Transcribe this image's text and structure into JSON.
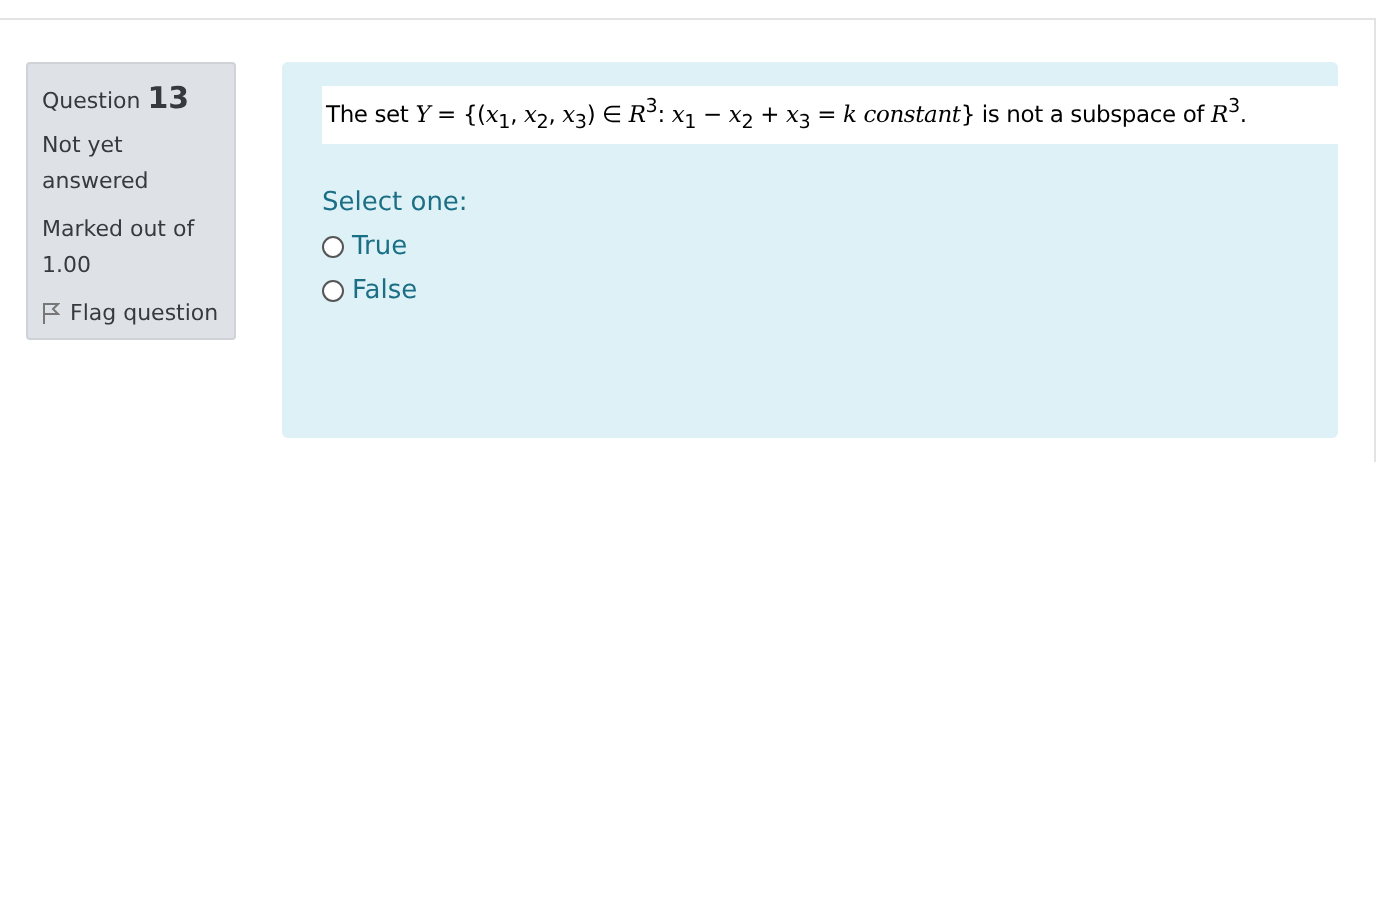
{
  "info": {
    "label": "Question",
    "number": "13",
    "state": "Not yet answered",
    "marks": "Marked out of 1.00",
    "flag": {
      "label": "Flag question",
      "flagged": false
    }
  },
  "question": {
    "text": "The set *Y* = {(*x*$_{1}$, *x*$_{2}$, *x*$_{3}$) ∈ *R*$^{3}$: *x*$_{1}$ − *x*$_{2}$ + *x*$_{3}$ = *k constant*} is not a subspace of *R*$^{3}$.",
    "prompt": "Select one:",
    "options": [
      {
        "label": "True",
        "selected": false
      },
      {
        "label": "False",
        "selected": false
      }
    ]
  }
}
